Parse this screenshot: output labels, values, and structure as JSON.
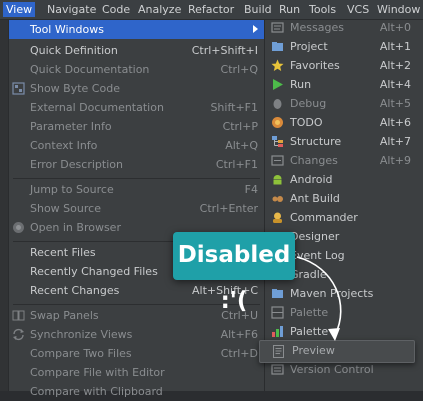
{
  "menubar": {
    "items": [
      "View",
      "Navigate",
      "Code",
      "Analyze",
      "Refactor",
      "Build",
      "Run",
      "Tools",
      "VCS",
      "Window"
    ]
  },
  "view_menu": {
    "tool_windows": "Tool Windows",
    "quick_definition": {
      "label": "Quick Definition",
      "shortcut": "Ctrl+Shift+I"
    },
    "quick_documentation": {
      "label": "Quick Documentation",
      "shortcut": "Ctrl+Q"
    },
    "show_byte_code": {
      "label": "Show Byte Code"
    },
    "external_documentation": {
      "label": "External Documentation",
      "shortcut": "Shift+F1"
    },
    "parameter_info": {
      "label": "Parameter Info",
      "shortcut": "Ctrl+P"
    },
    "context_info": {
      "label": "Context Info",
      "shortcut": "Alt+Q"
    },
    "error_description": {
      "label": "Error Description",
      "shortcut": "Ctrl+F1"
    },
    "jump_to_source": {
      "label": "Jump to Source",
      "shortcut": "F4"
    },
    "show_source": {
      "label": "Show Source",
      "shortcut": "Ctrl+Enter"
    },
    "open_in_browser": {
      "label": "Open in Browser"
    },
    "recent_files": {
      "label": "Recent Files"
    },
    "recently_changed_files": {
      "label": "Recently Changed Files"
    },
    "recent_changes": {
      "label": "Recent Changes",
      "shortcut": "Alt+Shift+C"
    },
    "swap_panels": {
      "label": "Swap Panels",
      "shortcut": "Ctrl+U"
    },
    "synchronize_views": {
      "label": "Synchronize Views",
      "shortcut": "Alt+F6"
    },
    "compare_two_files": {
      "label": "Compare Two Files",
      "shortcut": "Ctrl+D"
    },
    "compare_file_with_editor": {
      "label": "Compare File with Editor"
    },
    "compare_with_clipboard": {
      "label": "Compare with Clipboard"
    }
  },
  "tool_windows_submenu": {
    "messages": {
      "label": "Messages",
      "shortcut": "Alt+0"
    },
    "project": {
      "label": "Project",
      "shortcut": "Alt+1"
    },
    "favorites": {
      "label": "Favorites",
      "shortcut": "Alt+2"
    },
    "run": {
      "label": "Run",
      "shortcut": "Alt+4"
    },
    "debug": {
      "label": "Debug",
      "shortcut": "Alt+5"
    },
    "todo": {
      "label": "TODO",
      "shortcut": "Alt+6"
    },
    "structure": {
      "label": "Structure",
      "shortcut": "Alt+7"
    },
    "changes": {
      "label": "Changes",
      "shortcut": "Alt+9"
    },
    "android": {
      "label": "Android"
    },
    "ant_build": {
      "label": "Ant Build"
    },
    "commander": {
      "label": "Commander"
    },
    "designer": {
      "label": "Designer"
    },
    "event_log": {
      "label": "Event Log"
    },
    "gradle": {
      "label": "Gradle"
    },
    "maven_projects": {
      "label": "Maven Projects"
    },
    "palette1": {
      "label": "Palette"
    },
    "palette2": {
      "label": "Palette"
    },
    "preview": {
      "label": "Preview"
    },
    "version_control": {
      "label": "Version Control"
    }
  },
  "callout": {
    "text": "Disabled :'("
  },
  "colors": {
    "accent": "#2f65ca",
    "callout": "#1fa0a8",
    "menu_bg": "#3c3f41"
  }
}
